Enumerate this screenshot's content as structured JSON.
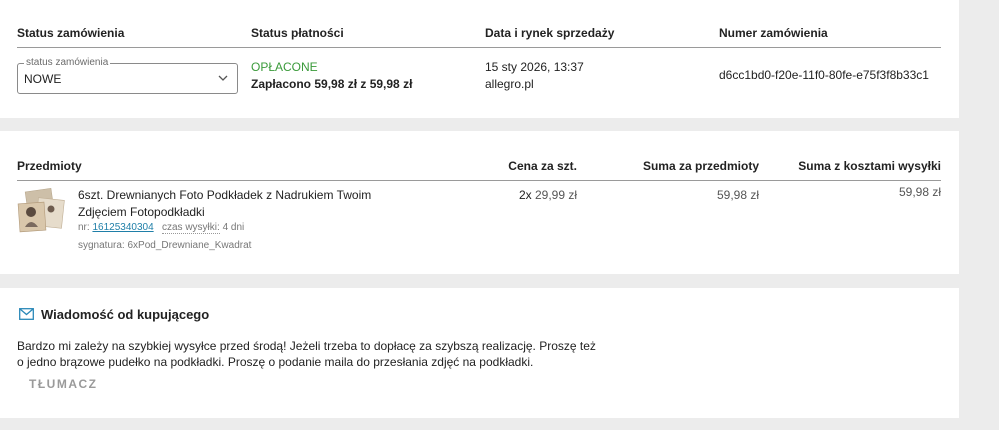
{
  "order_header": {
    "col_status": "Status zamówienia",
    "col_payment": "Status płatności",
    "col_date": "Data i rynek sprzedaży",
    "col_number": "Numer zamówienia"
  },
  "order_status": {
    "legend": "status zamówienia",
    "value": "NOWE"
  },
  "payment": {
    "status": "OPŁACONE",
    "paid_text": "Zapłacono 59,98 zł z 59,98 zł"
  },
  "sale": {
    "date": "15 sty 2026, 13:37",
    "market": "allegro.pl"
  },
  "order_number": "d6cc1bd0-f20e-11f0-80fe-e75f3f8b33c1",
  "items_header": {
    "col_items": "Przedmioty",
    "col_unit_price": "Cena za szt.",
    "col_items_sum": "Suma za przedmioty",
    "col_total_shipping": "Suma z kosztami wysyłki"
  },
  "item": {
    "title_line1": "6szt. Drewnianych Foto Podkładek z Nadrukiem Twoim",
    "title_line2": "Zdjęciem Fotopodkładki",
    "nr_label": "nr:",
    "nr_value": "16125340304",
    "shipping_label": "czas wysyłki:",
    "shipping_value": "4 dni",
    "signature": "sygnatura: 6xPod_Drewniane_Kwadrat",
    "qty": "2x",
    "unit_price": "29,99 zł",
    "items_sum": "59,98 zł",
    "total_with_shipping": "59,98 zł"
  },
  "message": {
    "title": "Wiadomość od kupującego",
    "line1": "Bardzo mi zależy na szybkiej wysyłce przed środą! Jeżeli trzeba to dopłacę za szybszą realizację. Proszę też",
    "line2": "o jedno brązowe pudełko na podkładki. Proszę o podanie maila do przesłania zdjęć na podkładki.",
    "translate_label": "TŁUMACZ"
  },
  "colors": {
    "paid_green": "#3a9a3a",
    "link_blue": "#1f7fa8",
    "page_bg": "#ececec"
  }
}
